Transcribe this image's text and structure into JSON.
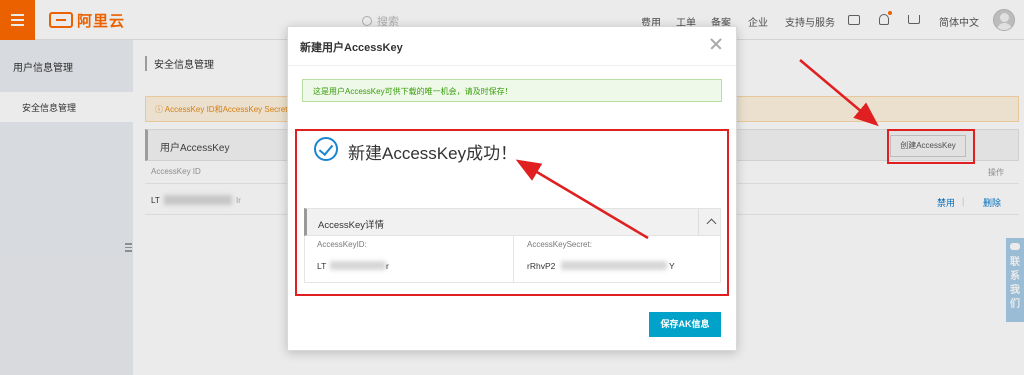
{
  "header": {
    "logo_text": "阿里云",
    "search_placeholder": "搜索",
    "nav": [
      "费用",
      "工单",
      "备案",
      "企业",
      "支持与服务",
      "简体中文"
    ]
  },
  "sidebar": {
    "title": "用户信息管理",
    "items": [
      {
        "label": "安全信息管理"
      }
    ]
  },
  "main": {
    "title": "安全信息管理",
    "warning": "AccessKey ID和AccessKey Secret",
    "panel_title": "用户AccessKey",
    "create_button": "创建AccessKey",
    "table": {
      "columns": [
        "AccessKey ID",
        "操作"
      ],
      "rows": [
        {
          "id_prefix": "LT",
          "id_suffix": "Ir",
          "actions": [
            "禁用",
            "删除"
          ]
        }
      ]
    }
  },
  "contact_widget": {
    "text": "联系我们"
  },
  "modal": {
    "title": "新建用户AccessKey",
    "notice": "这是用户AccessKey可供下载的唯一机会，请及时保存！",
    "success_text": "新建AccessKey成功！",
    "details_title": "AccessKey详情",
    "fields": [
      {
        "label": "AccessKeyID:",
        "value_prefix": "LT",
        "value_suffix": "r"
      },
      {
        "label": "AccessKeySecret:",
        "value_prefix": "rRhvP2",
        "value_suffix": "Y"
      }
    ],
    "save_button": "保存AK信息"
  },
  "colors": {
    "brand": "#ff6a00",
    "primary_button": "#00a2ca",
    "annotation_red": "#e02020",
    "success_blue": "#1a85d0"
  }
}
